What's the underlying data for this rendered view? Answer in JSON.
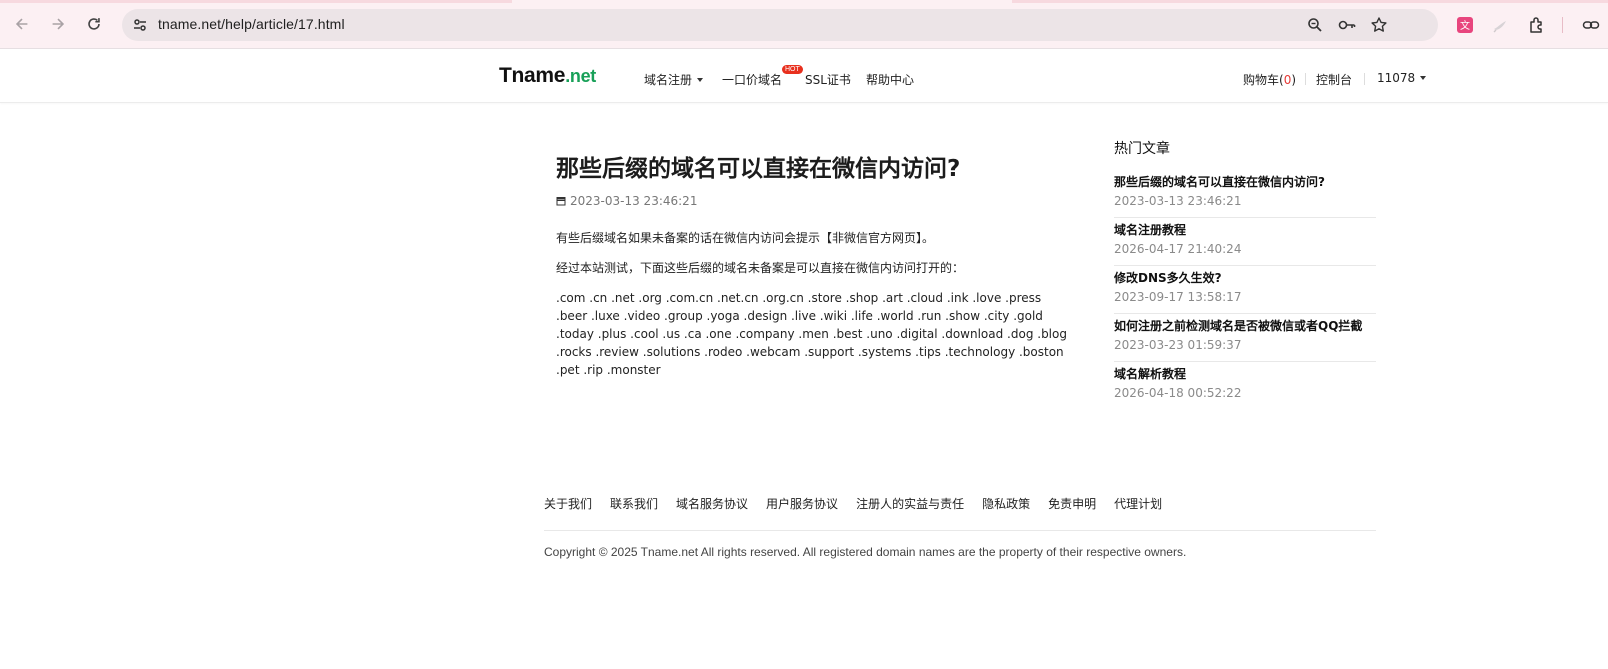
{
  "browser": {
    "url": "tname.net/help/article/17.html",
    "toolbar_icons": [
      "back-arrow-icon",
      "forward-arrow-icon",
      "reload-icon",
      "site-info-icon",
      "zoom-icon",
      "password-key-icon",
      "bookmark-star-icon",
      "translate-extension-icon",
      "extension-icon-2",
      "extensions-puzzle-icon",
      "link-icon"
    ],
    "accent": "#e8457d"
  },
  "header": {
    "logo_main": "Tname",
    "logo_tld": ".net",
    "nav": {
      "domain_register": "域名注册",
      "fixed_price": "一口价域名",
      "hot_badge": "HOT",
      "ssl": "SSL证书",
      "help": "帮助中心"
    },
    "right": {
      "cart_label": "购物车(",
      "cart_count": "0",
      "cart_close": ")",
      "console": "控制台",
      "user": "11078"
    }
  },
  "article": {
    "title": "那些后缀的域名可以直接在微信内访问?",
    "date": "2023-03-13 23:46:21",
    "paragraphs": [
      "有些后缀域名如果未备案的话在微信内访问会提示【非微信官方网页】。",
      "经过本站测试，下面这些后缀的域名未备案是可以直接在微信内访问打开的：",
      ".com .cn .net .org .com.cn .net.cn .org.cn .store .shop .art .cloud .ink .love .press .beer .luxe .video .group .yoga .design .live .wiki .life .world .run .show .city .gold .today .plus .cool .us .ca .one .company .men .best .uno .digital .download .dog .blog .rocks .review .solutions .rodeo .webcam .support .systems .tips .technology .boston .pet .rip .monster"
    ]
  },
  "sidebar": {
    "heading": "热门文章",
    "items": [
      {
        "title": "那些后缀的域名可以直接在微信内访问?",
        "date": "2023-03-13 23:46:21"
      },
      {
        "title": "域名注册教程",
        "date": "2026-04-17 21:40:24"
      },
      {
        "title": "修改DNS多久生效?",
        "date": "2023-09-17 13:58:17"
      },
      {
        "title": "如何注册之前检测域名是否被微信或者QQ拦截",
        "date": "2023-03-23 01:59:37"
      },
      {
        "title": "域名解析教程",
        "date": "2026-04-18 00:52:22"
      }
    ]
  },
  "footer": {
    "links": [
      "关于我们",
      "联系我们",
      "域名服务协议",
      "用户服务协议",
      "注册人的实益与责任",
      "隐私政策",
      "免责申明",
      "代理计划"
    ],
    "copyright": "Copyright © 2025 Tname.net All rights reserved. All registered domain names are the property of their respective owners."
  },
  "colors": {
    "logo_tld": "#18a058",
    "cart_count": "#e53935",
    "hot_badge": "#e8301e"
  }
}
